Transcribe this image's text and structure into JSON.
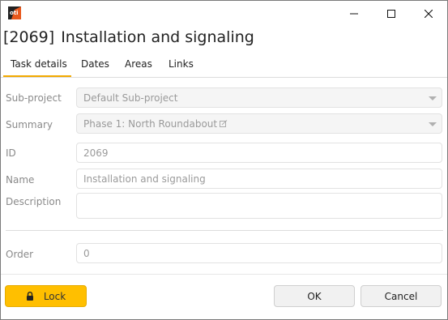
{
  "window": {
    "app_icon": "app-logo-icon",
    "controls": {
      "minimize": "minimize-icon",
      "maximize": "maximize-icon",
      "close": "close-icon"
    }
  },
  "header": {
    "id": "[2069]",
    "title": "Installation and signaling"
  },
  "tabs": [
    {
      "label": "Task details",
      "active": true
    },
    {
      "label": "Dates"
    },
    {
      "label": "Areas"
    },
    {
      "label": "Links"
    }
  ],
  "form": {
    "sub_project": {
      "label": "Sub-project",
      "value": "Default Sub-project"
    },
    "summary": {
      "label": "Summary",
      "value": "Phase 1: North Roundabout"
    },
    "id": {
      "label": "ID",
      "value": "2069"
    },
    "name": {
      "label": "Name",
      "value": "Installation and signaling"
    },
    "description": {
      "label": "Description",
      "value": ""
    },
    "order": {
      "label": "Order",
      "value": "0"
    }
  },
  "footer": {
    "lock_label": "Lock",
    "ok_label": "OK",
    "cancel_label": "Cancel"
  },
  "colors": {
    "accent": "#ffbf00",
    "tab_underline": "#f2a900"
  }
}
